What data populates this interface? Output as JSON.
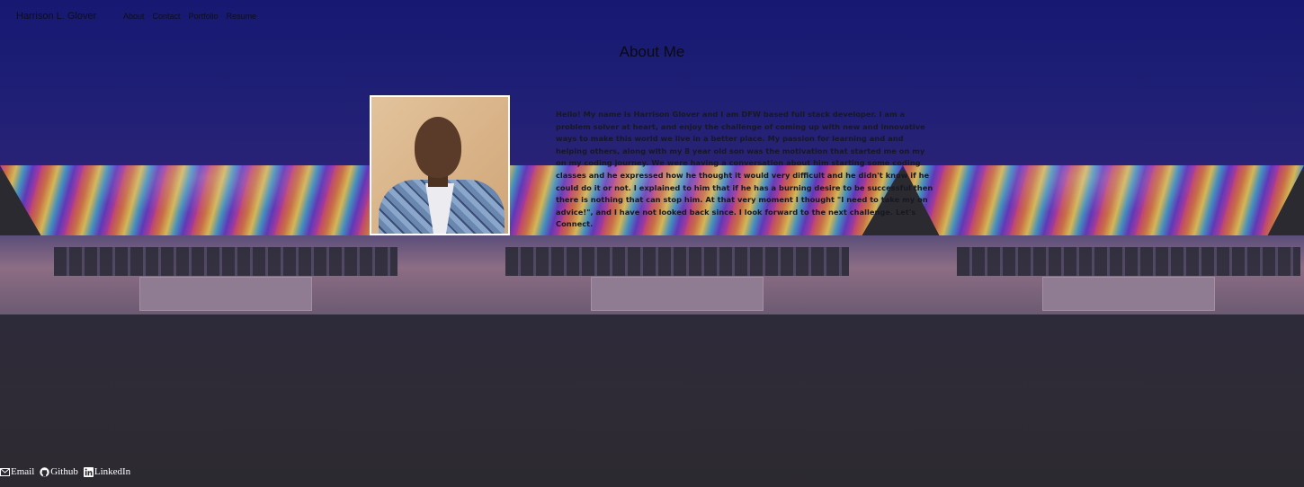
{
  "nav": {
    "brand": "Harrison L. Glover",
    "links": [
      "About",
      "Contact",
      "Portfolio",
      "Resume"
    ]
  },
  "about": {
    "title": "About Me",
    "bio": "Hello! My name is Harrison Glover and I am DFW based full stack developer. I am a problem solver at heart, and enjoy the challenge of coming up with new and innovative ways to make this world we live in a better place. My passion for learning and and helping others, along with my 8 year old son was the motivation that started me on my on my coding journey. We were having a conversation about him starting some coding classes and he expressed how he thought it would very difficult and he didn't know if he could do it or not. I explained to him that if he has a burning desire to be successful then there is nothing that can stop him. At that very moment I thought \"I need to take my on advice!\", and I have not looked back since. I look forward to the next challenge. Let's Connect."
  },
  "footer": {
    "links": [
      {
        "label": "Email",
        "icon": "envelope-icon"
      },
      {
        "label": "Github",
        "icon": "github-icon"
      },
      {
        "label": "LinkedIn",
        "icon": "linkedin-icon"
      }
    ]
  },
  "colors": {
    "sky": "#161872",
    "floor": "#2c2a30",
    "text_dark": "#0e0e18",
    "footer_text": "#ffffff"
  }
}
